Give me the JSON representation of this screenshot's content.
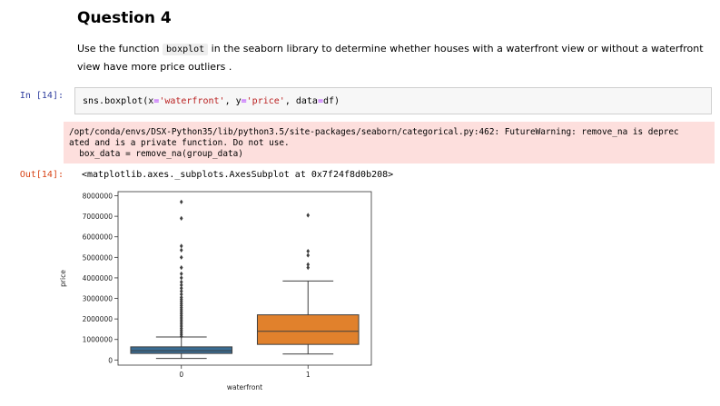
{
  "heading": "Question 4",
  "instruction": {
    "before": "Use the function ",
    "code": "boxplot",
    "after": " in the seaborn library to determine whether houses with a waterfront view or without a waterfront view have more price outliers ."
  },
  "cells": {
    "in_prompt": "In [14]:",
    "input_code": {
      "p1": "sns.boxplot(x",
      "eq1": "=",
      "s1": "'waterfront'",
      "p2": ", y",
      "eq2": "=",
      "s2": "'price'",
      "p3": ", data",
      "eq3": "=",
      "p4": "df)"
    },
    "stderr_text": "/opt/conda/envs/DSX-Python35/lib/python3.5/site-packages/seaborn/categorical.py:462: FutureWarning: remove_na is deprec\nated and is a private function. Do not use.\n  box_data = remove_na(group_data)",
    "out_prompt": "Out[14]:",
    "output_text": "<matplotlib.axes._subplots.AxesSubplot at 0x7f24f8d0b208>"
  },
  "chart_data": {
    "type": "boxplot",
    "xlabel": "waterfront",
    "ylabel": "price",
    "ylim": [
      -250000,
      8200000
    ],
    "yticks": [
      0,
      1000000,
      2000000,
      3000000,
      4000000,
      5000000,
      6000000,
      7000000,
      8000000
    ],
    "ytick_labels": [
      "0",
      "1000000",
      "2000000",
      "3000000",
      "4000000",
      "5000000",
      "6000000",
      "7000000",
      "8000000"
    ],
    "categories": [
      "0",
      "1"
    ],
    "boxes": [
      {
        "category": "0",
        "color": "#3a6d94",
        "whisker_low": 75000,
        "q1": 320000,
        "median": 450000,
        "q3": 640000,
        "whisker_high": 1120000,
        "outliers": [
          1150000,
          1250000,
          1350000,
          1450000,
          1550000,
          1650000,
          1750000,
          1850000,
          1950000,
          2050000,
          2150000,
          2250000,
          2350000,
          2450000,
          2550000,
          2650000,
          2750000,
          2850000,
          2950000,
          3050000,
          3200000,
          3350000,
          3500000,
          3650000,
          3800000,
          4000000,
          4200000,
          4500000,
          5000000,
          5350000,
          5550000,
          6900000,
          7700000
        ]
      },
      {
        "category": "1",
        "color": "#e1812c",
        "whisker_low": 290000,
        "q1": 760000,
        "median": 1400000,
        "q3": 2200000,
        "whisker_high": 3850000,
        "outliers": [
          4500000,
          4650000,
          5100000,
          5300000,
          7050000
        ]
      }
    ],
    "grid": false
  }
}
